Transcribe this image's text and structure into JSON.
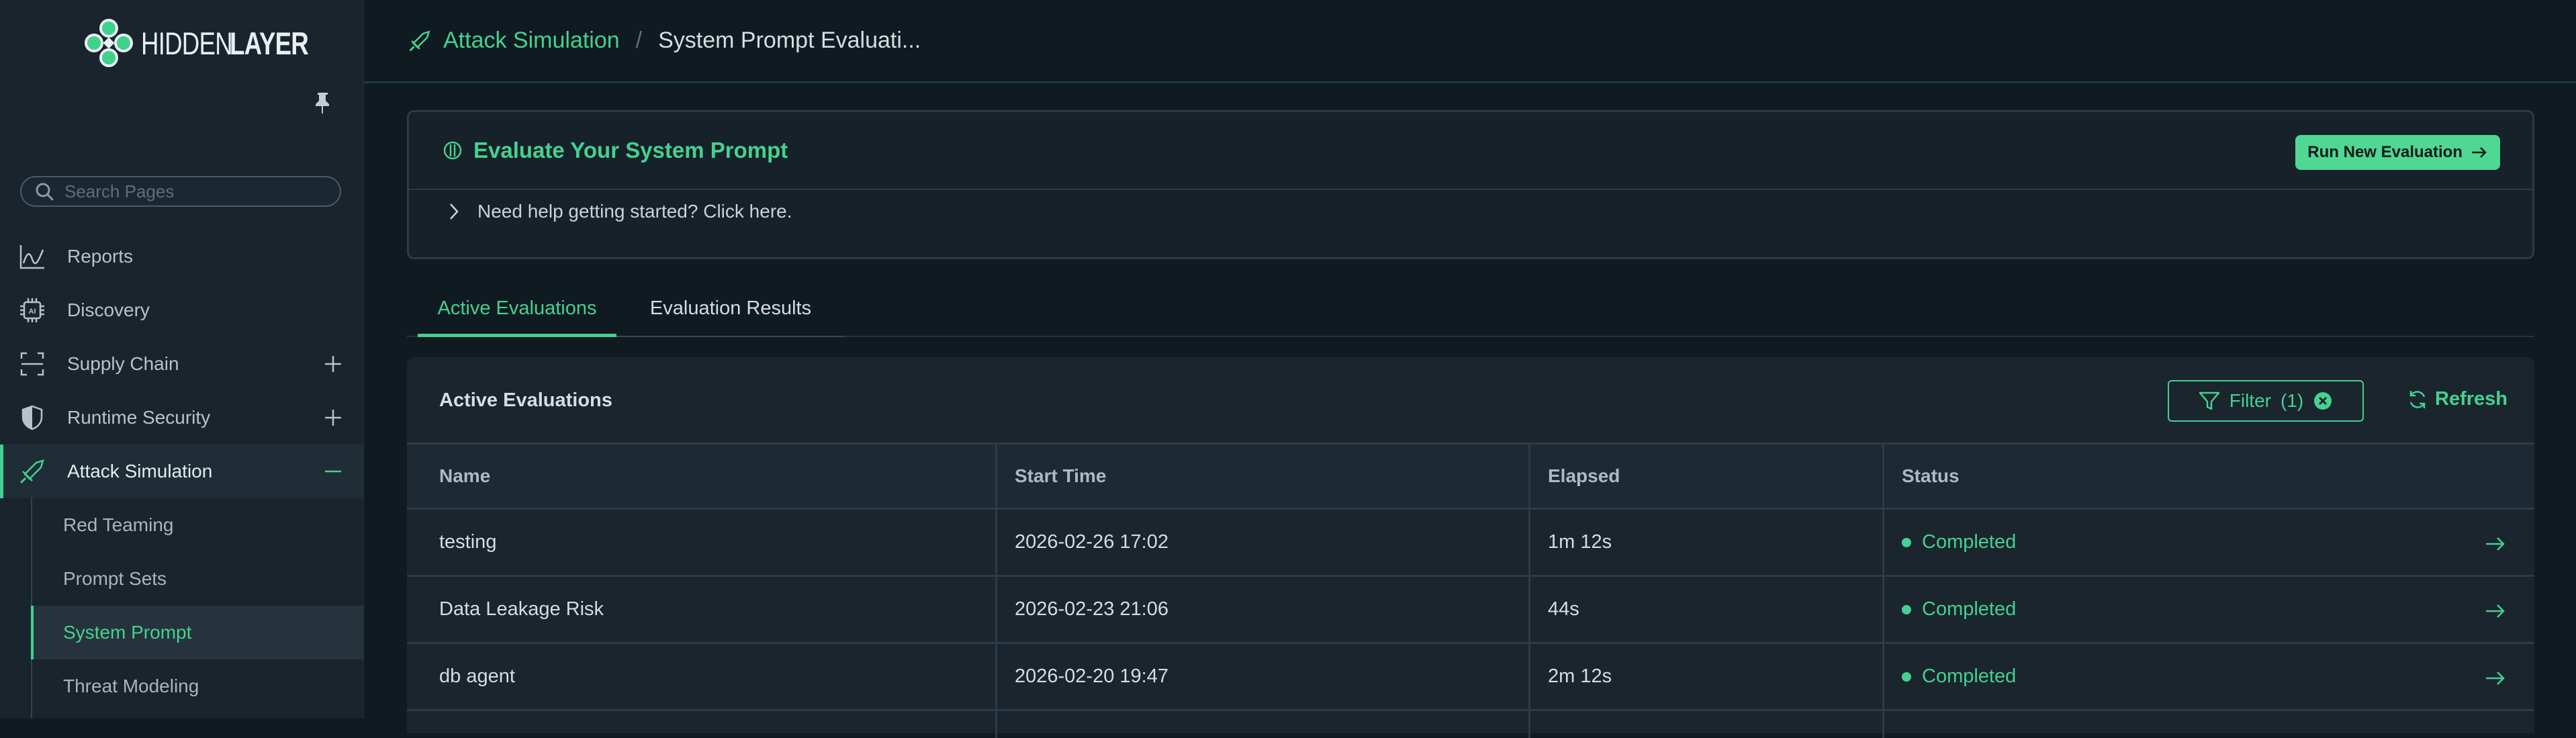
{
  "brand": {
    "name_light": "HIDDEN",
    "name_bold": "LAYER",
    "accent": "#45d18f"
  },
  "search": {
    "placeholder": "Search Pages"
  },
  "nav": {
    "items": [
      {
        "label": "Reports",
        "icon": "line-chart-icon"
      },
      {
        "label": "Discovery",
        "icon": "chip-icon"
      },
      {
        "label": "Supply Chain",
        "icon": "scan-icon",
        "expand": "plus-icon"
      },
      {
        "label": "Runtime Security",
        "icon": "shield-icon",
        "expand": "plus-icon"
      },
      {
        "label": "Attack Simulation",
        "icon": "sword-icon",
        "expand": "minus-icon"
      }
    ],
    "subitems": [
      {
        "label": "Red Teaming"
      },
      {
        "label": "Prompt Sets"
      },
      {
        "label": "System Prompt"
      },
      {
        "label": "Threat Modeling"
      }
    ]
  },
  "breadcrumb": {
    "parent": "Attack Simulation",
    "separator": "/",
    "current": "System Prompt Evaluati..."
  },
  "eval_card": {
    "title": "Evaluate Your System Prompt",
    "run_button": "Run New Evaluation",
    "help_text": "Need help getting started? Click here."
  },
  "tabs": [
    {
      "label": "Active Evaluations",
      "active": true
    },
    {
      "label": "Evaluation Results",
      "active": false
    }
  ],
  "table": {
    "title": "Active Evaluations",
    "filter_label": "Filter",
    "filter_count": "(1)",
    "refresh_label": "Refresh",
    "columns": [
      "Name",
      "Start Time",
      "Elapsed",
      "Status"
    ],
    "rows": [
      {
        "name": "testing",
        "start": "2026-02-26 17:02",
        "elapsed": "1m 12s",
        "status": "Completed"
      },
      {
        "name": "Data Leakage Risk",
        "start": "2026-02-23 21:06",
        "elapsed": "44s",
        "status": "Completed"
      },
      {
        "name": "db agent",
        "start": "2026-02-20 19:47",
        "elapsed": "2m 12s",
        "status": "Completed"
      }
    ]
  }
}
